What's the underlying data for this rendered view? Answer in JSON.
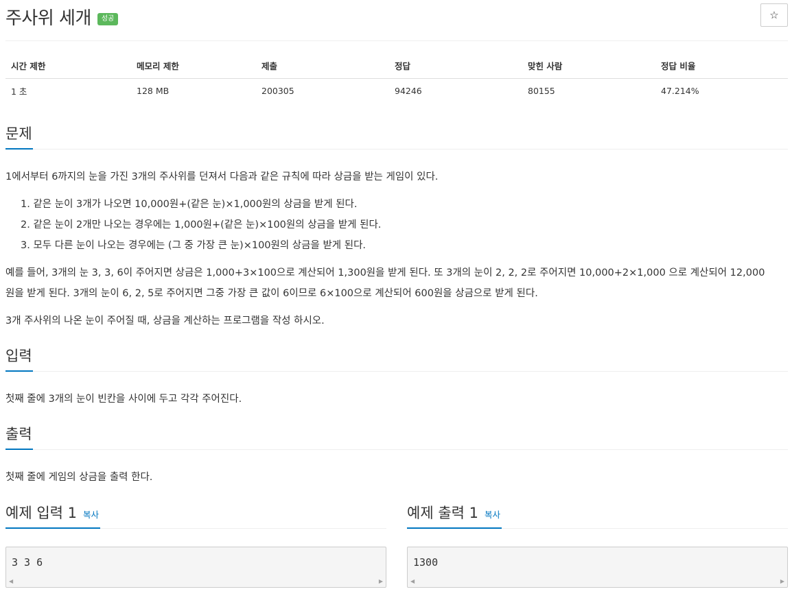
{
  "problem": {
    "title": "주사위 세개",
    "status_badge": "성공",
    "star_glyph": "☆"
  },
  "info_table": {
    "headers": [
      "시간 제한",
      "메모리 제한",
      "제출",
      "정답",
      "맞힌 사람",
      "정답 비율"
    ],
    "values": [
      "1 초",
      "128 MB",
      "200305",
      "94246",
      "80155",
      "47.214%"
    ]
  },
  "sections": {
    "problem": {
      "heading": "문제",
      "intro": "1에서부터 6까지의 눈을 가진 3개의 주사위를 던져서 다음과 같은 규칙에 따라 상금을 받는 게임이 있다.",
      "rules": [
        "1. 같은 눈이 3개가 나오면 10,000원+(같은 눈)×1,000원의 상금을 받게 된다.",
        "2. 같은 눈이 2개만 나오는 경우에는 1,000원+(같은 눈)×100원의 상금을 받게 된다.",
        "3. 모두 다른 눈이 나오는 경우에는 (그 중 가장 큰 눈)×100원의 상금을 받게 된다."
      ],
      "example_line1": "예를 들어, 3개의 눈 3, 3, 6이 주어지면 상금은 1,000+3×100으로 계산되어 1,300원을 받게 된다. 또 3개의 눈이 2, 2, 2로 주어지면 10,000+2×1,000 으로 계산되어 12,000",
      "example_line2": "원을 받게 된다. 3개의 눈이 6, 2, 5로 주어지면 그중 가장 큰 값이 6이므로 6×100으로 계산되어 600원을 상금으로 받게 된다.",
      "task": "3개 주사위의 나온 눈이 주어질 때, 상금을 계산하는 프로그램을 작성 하시오."
    },
    "input": {
      "heading": "입력",
      "body": "첫째 줄에 3개의 눈이 빈칸을 사이에 두고 각각 주어진다."
    },
    "output": {
      "heading": "출력",
      "body": "첫째 줄에 게임의 상금을 출력 한다."
    }
  },
  "samples": {
    "input": {
      "heading": "예제 입력 1",
      "copy_label": "복사",
      "content": "3 3 6"
    },
    "output": {
      "heading": "예제 출력 1",
      "copy_label": "복사",
      "content": "1300"
    }
  },
  "colors": {
    "accent": "#0076c0",
    "badge_success": "#5cb85c"
  }
}
